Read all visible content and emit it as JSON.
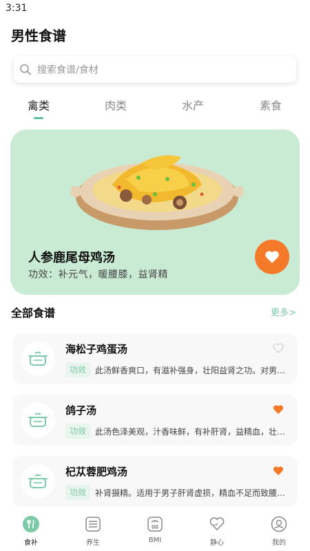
{
  "status_bar": {
    "time": "3:31"
  },
  "header": {
    "title": "男性食谱"
  },
  "search": {
    "placeholder": "搜索食谱/食材"
  },
  "tabs": [
    {
      "label": "禽类",
      "active": true
    },
    {
      "label": "肉类",
      "active": false
    },
    {
      "label": "水产",
      "active": false
    },
    {
      "label": "素食",
      "active": false
    }
  ],
  "featured": {
    "title": "人参鹿尾母鸡汤",
    "effect": "功效：补元气，暖腰膝，益肾精",
    "favorited": true
  },
  "section": {
    "title": "全部食谱",
    "more": "更多>"
  },
  "recipes": [
    {
      "name": "海松子鸡蛋汤",
      "tag": "功效",
      "desc": "此汤鲜香爽口，有滋补强身，壮阳益肾之功。对男子阳痿...",
      "favorited": false
    },
    {
      "name": "鸽子汤",
      "tag": "功效",
      "desc": "此汤色泽美观，汁香味鲜，有补肝肾，益精血，壮阳起痿...",
      "favorited": true
    },
    {
      "name": "杞苁蓉肥鸡汤",
      "tag": "功效",
      "desc": "补肾摄精。适用于男子肝肾虚损，精血不足而致腰膝酸软...",
      "favorited": true
    }
  ],
  "bottom_nav": [
    {
      "label": "食补",
      "icon": "fork-knife-icon",
      "active": true
    },
    {
      "label": "养生",
      "icon": "list-icon",
      "active": false
    },
    {
      "label": "BMI",
      "icon": "scale-icon",
      "active": false
    },
    {
      "label": "静心",
      "icon": "heart-hand-icon",
      "active": false
    },
    {
      "label": "我的",
      "icon": "user-icon",
      "active": false
    }
  ],
  "colors": {
    "accent": "#5cc39a",
    "feature_bg": "#c9ebd4",
    "favorite": "#f47a2a"
  }
}
